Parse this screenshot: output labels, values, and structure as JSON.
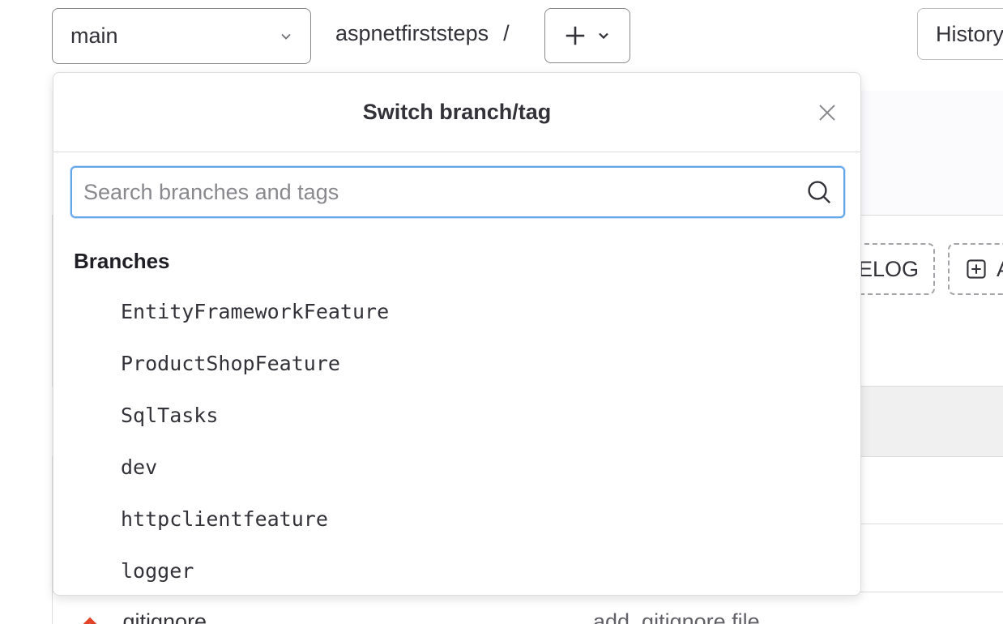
{
  "toolbar": {
    "branch_selected": "main",
    "repo_name": "aspnetfirststeps",
    "path_separator": "/",
    "history_label": "History"
  },
  "background": {
    "changelog_label": "ELOG",
    "add_label": "A",
    "file_name": ".gitignore",
    "commit_message": "add .gitignore file"
  },
  "popover": {
    "title": "Switch branch/tag",
    "search_placeholder": "Search branches and tags",
    "section_label": "Branches",
    "branches": [
      "EntityFrameworkFeature",
      "ProductShopFeature",
      "SqlTasks",
      "dev",
      "httpclientfeature",
      "logger"
    ]
  },
  "colors": {
    "search_focus_border": "#63a6e9",
    "file_icon": "#e24329"
  }
}
